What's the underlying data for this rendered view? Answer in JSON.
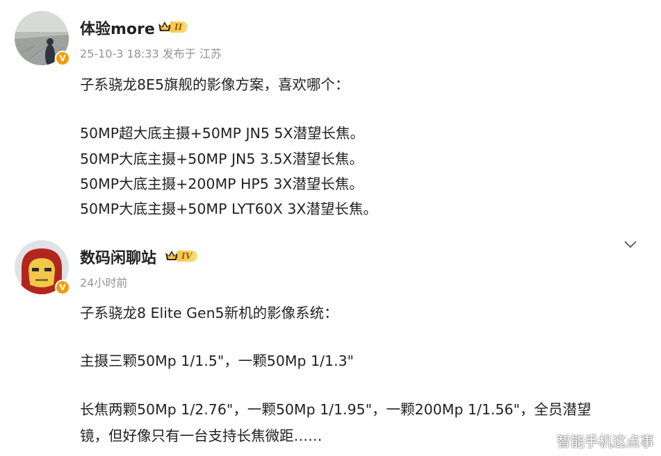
{
  "posts": [
    {
      "author": "体验more",
      "level": "II",
      "verified_mark": "V",
      "meta": "25-10-3 18:33 发布于 江苏",
      "lines": [
        "子系骁龙8E5旗舰的影像方案，喜欢哪个：",
        "",
        "50MP超大底主摄+50MP JN5 5X潜望长焦。",
        "50MP大底主摄+50MP JN5 3.5X潜望长焦。",
        "50MP大底主摄+200MP HP5 3X潜望长焦。",
        "50MP大底主摄+50MP LYT60X 3X潜望长焦。"
      ]
    },
    {
      "author": "数码闲聊站",
      "level": "IV",
      "verified_mark": "V",
      "meta": "24小时前",
      "lines": [
        "子系骁龙8 Elite Gen5新机的影像系统：",
        "",
        "主摄三颗50Mp 1/1.5\"，一颗50Mp 1/1.3\"",
        "",
        "长焦两颗50Mp 1/2.76\"，一颗50Mp 1/1.95\"，一颗200Mp 1/1.56\"，全员潜望",
        "镜，但好像只有一台支持长焦微距……"
      ]
    }
  ],
  "icons": {
    "level_crown": "crown-icon",
    "more": "chevron-down-icon"
  },
  "colors": {
    "verified": "#f39b00",
    "meta_text": "#939393",
    "level_badge": "#f6c54a"
  },
  "watermark": "智能手机这点事"
}
